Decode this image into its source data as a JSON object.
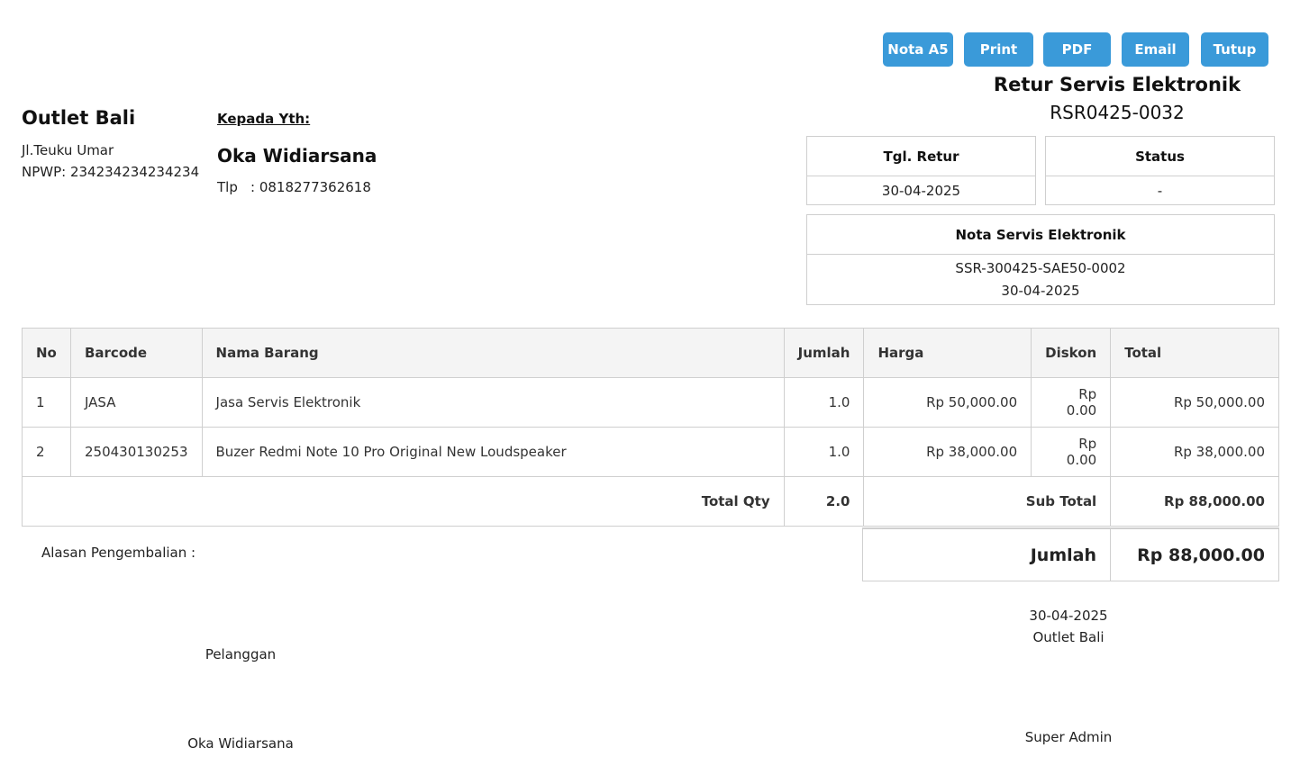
{
  "buttons": {
    "nota_a5": "Nota A5",
    "print": "Print",
    "pdf": "PDF",
    "email": "Email",
    "tutup": "Tutup"
  },
  "doc": {
    "title": "Retur Servis Elektronik",
    "number": "RSR0425-0032"
  },
  "outlet": {
    "name": "Outlet Bali",
    "address": "Jl.Teuku Umar",
    "npwp": "NPWP: 234234234234234"
  },
  "customer": {
    "heading": "Kepada Yth:",
    "name": "Oka Widiarsana",
    "phone_label": "Tlp",
    "phone": ": 0818277362618"
  },
  "info": {
    "tgl_retur_label": "Tgl. Retur",
    "tgl_retur": "30-04-2025",
    "status_label": "Status",
    "status": "-",
    "nota_label": "Nota Servis Elektronik",
    "nota_no": "SSR-300425-SAE50-0002",
    "nota_date": "30-04-2025"
  },
  "table": {
    "headers": {
      "no": "No",
      "barcode": "Barcode",
      "nama": "Nama Barang",
      "jumlah": "Jumlah",
      "harga": "Harga",
      "diskon": "Diskon",
      "total": "Total"
    },
    "rows": [
      {
        "no": "1",
        "barcode": "JASA",
        "nama": "Jasa Servis Elektronik",
        "jumlah": "1.0",
        "harga": "Rp 50,000.00",
        "diskon": "Rp 0.00",
        "total": "Rp 50,000.00"
      },
      {
        "no": "2",
        "barcode": "250430130253",
        "nama": "Buzer Redmi Note 10 Pro Original New Loudspeaker",
        "jumlah": "1.0",
        "harga": "Rp 38,000.00",
        "diskon": "Rp 0.00",
        "total": "Rp 38,000.00"
      }
    ],
    "total_qty_label": "Total Qty",
    "total_qty": "2.0",
    "subtotal_label": "Sub Total",
    "subtotal": "Rp 88,000.00"
  },
  "summary": {
    "jumlah_label": "Jumlah",
    "jumlah": "Rp 88,000.00"
  },
  "reason_label": "Alasan Pengembalian :",
  "signatures": {
    "date": "30-04-2025",
    "outlet": "Outlet Bali",
    "customer_role": "Pelanggan",
    "customer_name": "Oka Widiarsana",
    "admin_name": "Super Admin"
  }
}
